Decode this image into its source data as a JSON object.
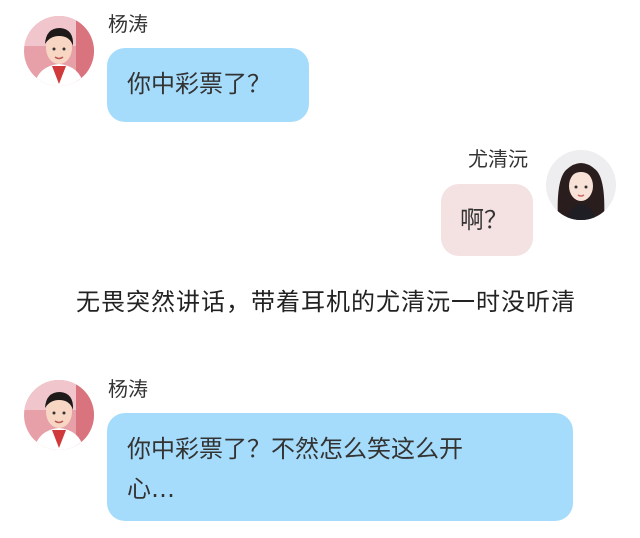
{
  "messages": [
    {
      "sender": "杨涛",
      "side": "left",
      "text": "你中彩票了？",
      "bubble_color": "#a6dcfb"
    },
    {
      "sender": "尤清沅",
      "side": "right",
      "text": "啊？",
      "bubble_color": "#f4e1e1"
    },
    {
      "sender": "杨涛",
      "side": "left",
      "text_line1": "你中彩票了？不然怎么笑这么开",
      "text_line2": "心…",
      "bubble_color": "#a6dcfb"
    }
  ],
  "narration": {
    "text": "无畏突然讲话，带着耳机的尤清沅一时没听清"
  },
  "avatars": {
    "yangtao": "male-avatar-icon",
    "youqingyuan": "female-avatar-icon"
  }
}
